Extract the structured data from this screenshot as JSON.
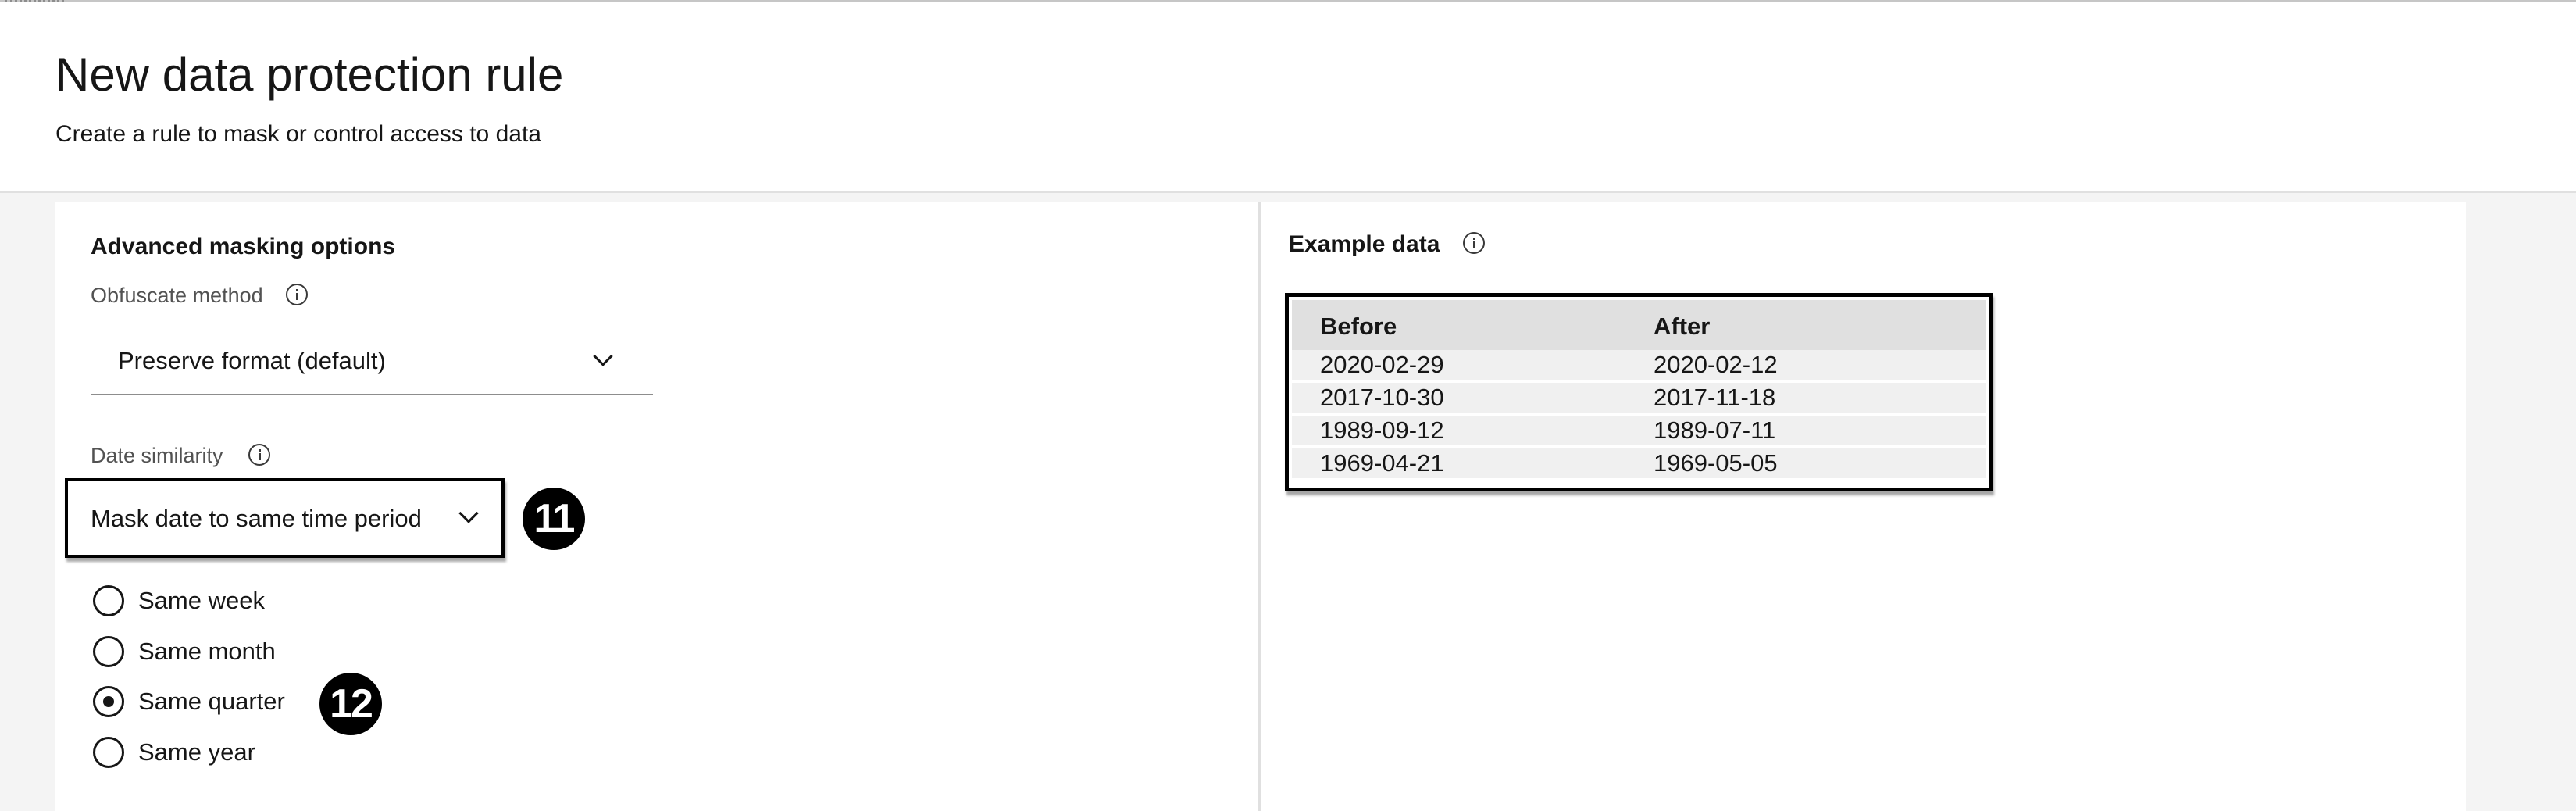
{
  "header": {
    "title": "New data protection rule",
    "subtitle": "Create a rule to mask or control access to data"
  },
  "advanced": {
    "section_title": "Advanced masking options",
    "obfuscate_label": "Obfuscate method",
    "obfuscate_value": "Preserve format (default)",
    "date_similarity_label": "Date similarity",
    "date_similarity_value": "Mask date to same time period",
    "radio_options": [
      {
        "label": "Same week",
        "checked": false
      },
      {
        "label": "Same month",
        "checked": false
      },
      {
        "label": "Same quarter",
        "checked": true
      },
      {
        "label": "Same year",
        "checked": false
      }
    ]
  },
  "callouts": {
    "badge_11": "11",
    "badge_12": "12"
  },
  "example": {
    "title": "Example data",
    "columns": [
      "Before",
      "After"
    ],
    "rows": [
      [
        "2020-02-29",
        "2020-02-12"
      ],
      [
        "2017-10-30",
        "2017-11-18"
      ],
      [
        "1989-09-12",
        "1989-07-11"
      ],
      [
        "1969-04-21",
        "1969-05-05"
      ]
    ]
  },
  "icons": [
    "info-icon",
    "chevron-down-icon"
  ],
  "colors": {
    "callout": "#000000",
    "label_gray": "#525252",
    "table_header": "#e0e0e0",
    "row_bg": "#f0f0f0"
  }
}
